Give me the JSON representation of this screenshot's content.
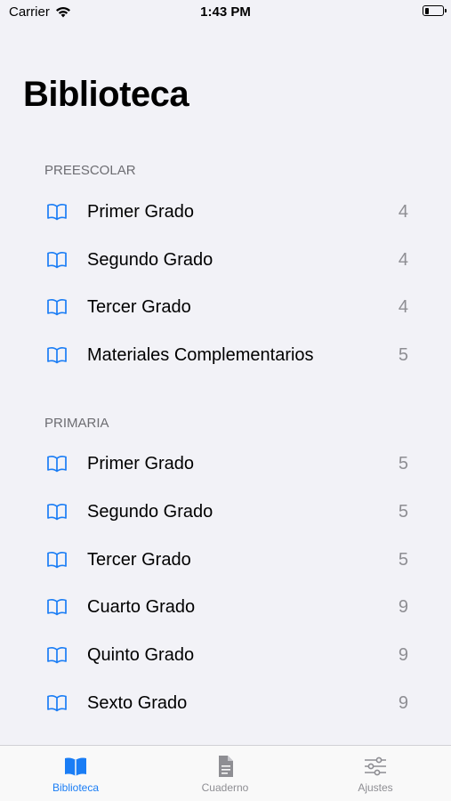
{
  "status": {
    "carrier": "Carrier",
    "time": "1:43 PM"
  },
  "header": {
    "title": "Biblioteca"
  },
  "sections": [
    {
      "title": "PREESCOLAR",
      "items": [
        {
          "label": "Primer Grado",
          "count": "4"
        },
        {
          "label": "Segundo Grado",
          "count": "4"
        },
        {
          "label": "Tercer Grado",
          "count": "4"
        },
        {
          "label": "Materiales Complementarios",
          "count": "5"
        }
      ]
    },
    {
      "title": "PRIMARIA",
      "items": [
        {
          "label": "Primer Grado",
          "count": "5"
        },
        {
          "label": "Segundo Grado",
          "count": "5"
        },
        {
          "label": "Tercer Grado",
          "count": "5"
        },
        {
          "label": "Cuarto Grado",
          "count": "9"
        },
        {
          "label": "Quinto Grado",
          "count": "9"
        },
        {
          "label": "Sexto Grado",
          "count": "9"
        }
      ]
    }
  ],
  "tabbar": {
    "tabs": [
      {
        "label": "Biblioteca",
        "icon": "book-icon"
      },
      {
        "label": "Cuaderno",
        "icon": "document-icon"
      },
      {
        "label": "Ajustes",
        "icon": "sliders-icon"
      }
    ]
  },
  "colors": {
    "accent": "#1a7df5",
    "background": "#f2f2f7",
    "secondary_text": "#8e8e93"
  }
}
